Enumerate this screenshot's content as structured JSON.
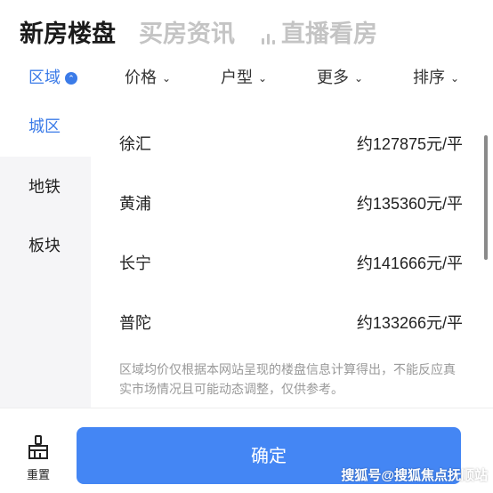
{
  "top_tabs": [
    {
      "label": "新房楼盘"
    },
    {
      "label": "买房资讯"
    },
    {
      "label": "直播看房"
    }
  ],
  "filters": [
    {
      "label": "区域"
    },
    {
      "label": "价格"
    },
    {
      "label": "户型"
    },
    {
      "label": "更多"
    },
    {
      "label": "排序"
    }
  ],
  "categories": [
    {
      "label": "城区"
    },
    {
      "label": "地铁"
    },
    {
      "label": "板块"
    }
  ],
  "districts": [
    {
      "name": "徐汇",
      "price": "约127875元/平"
    },
    {
      "name": "黄浦",
      "price": "约135360元/平"
    },
    {
      "name": "长宁",
      "price": "约141666元/平"
    },
    {
      "name": "普陀",
      "price": "约133266元/平"
    }
  ],
  "note": "区域均价仅根据本网站呈现的楼盘信息计算得出，不能反应真实市场情况且可能动态调整，仅供参考。",
  "bottom": {
    "reset_label": "重置",
    "confirm_label": "确定"
  },
  "watermark": "搜狐号@搜狐焦点抚顺站",
  "colors": {
    "accent": "#3b7be8",
    "confirm_bg": "#4486f4",
    "inactive_tab": "#c4c4c4"
  }
}
